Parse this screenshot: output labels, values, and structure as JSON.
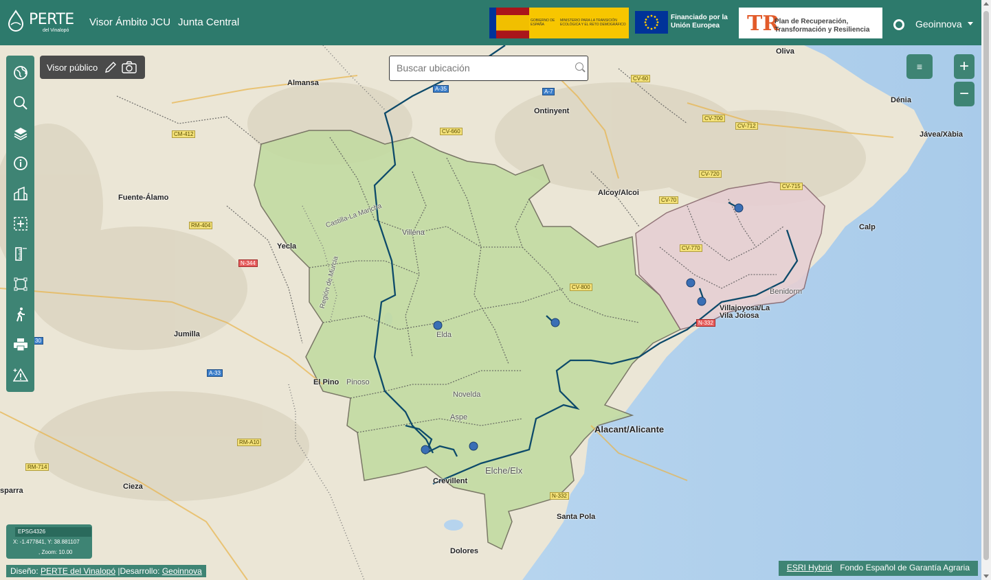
{
  "header": {
    "logo_text": "PERTE",
    "logo_sub": "del Vinalopó",
    "nav": [
      "Visor Ámbito JCU",
      "Junta Central"
    ],
    "gob_text_1": "GOBIERNO DE ESPAÑA",
    "gob_text_2": "MINISTERIO PARA LA TRANSICIÓN ECOLÓGICA Y EL RETO DEMOGRÁFICO",
    "eu_text": "Financiado por la Unión Europea",
    "prtr_mark": "TR",
    "prtr_text": "Plan de Recuperación, Transformación y Resiliencia",
    "user": "Geoinnova"
  },
  "search": {
    "placeholder": "Buscar ubicación"
  },
  "visor": {
    "label": "Visor público"
  },
  "toolbar": {
    "tools": [
      "globe-icon",
      "search-icon",
      "layers-icon",
      "info-icon",
      "buildings-icon",
      "add-area-icon",
      "ruler-icon",
      "extent-icon",
      "walk-icon",
      "print-icon",
      "alert-icon"
    ]
  },
  "map_controls": {
    "legend": "≡",
    "zoom_in": "+",
    "zoom_out": "−"
  },
  "coords": {
    "epsg": "EPSG4326",
    "xy": "X: -1.477841, Y: 38.881107",
    "zoom": ", Zoom: 10.00"
  },
  "credit": {
    "prefix": "Diseño: ",
    "design": "PERTE del Vinalopó",
    "mid": " |Desarrollo: ",
    "dev": "Geoinnova"
  },
  "attribution": {
    "esri": "ESRI Hybrid",
    "fega": "Fondo Español de Garantía Agraria"
  },
  "places": [
    "Oliva",
    "Almansa",
    "Ontinyent",
    "Dénia",
    "Jávea/Xàbia",
    "Fuente-Álamo",
    "Alcoy/Alcoi",
    "Calp",
    "Villena",
    "Yecla",
    "Benidorm",
    "Villajoyosa/La Vila Joiosa",
    "Elda",
    "Jumilla",
    "El Pino",
    "Pinoso",
    "Novelda",
    "Aspe",
    "Alacant/Alicante",
    "Elche/Elx",
    "Crevillent",
    "Cieza",
    "Santa Pola",
    "Dolores",
    "sparra",
    "Castilla-La Mancha",
    "Región de Murcia"
  ],
  "roads": [
    "A-35",
    "A-7",
    "CV-60",
    "CM-412",
    "CV-660",
    "CV-700",
    "CV-712",
    "CV-720",
    "CV-715",
    "CV-70",
    "RM-404",
    "N-344",
    "CV-770",
    "CV-800",
    "A-33",
    "RM-A10",
    "RM-714",
    "N-332",
    "N-332",
    "30"
  ]
}
